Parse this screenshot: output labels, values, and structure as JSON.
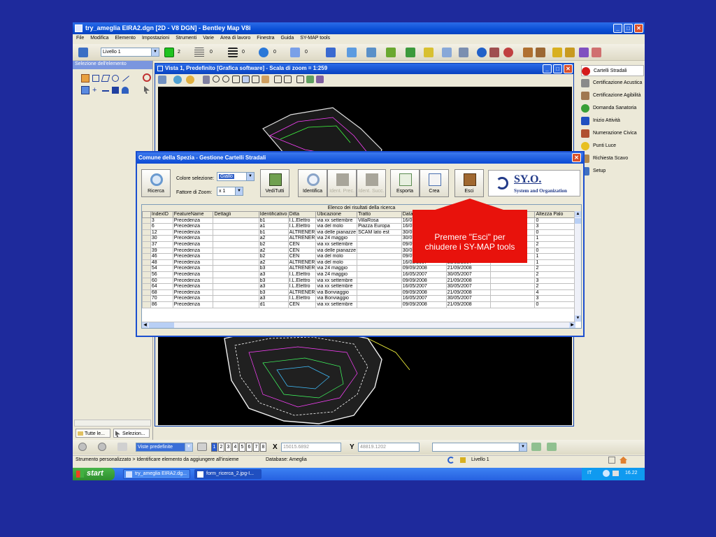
{
  "app": {
    "title": "try_ameglia EIRA2.dgn [2D - V8 DGN] - Bentley Map V8i",
    "menu": [
      "File",
      "Modifica",
      "Elemento",
      "Impostazioni",
      "Strumenti",
      "Varie",
      "Area di lavoro",
      "Finestra",
      "Guida",
      "SY-MAP tools"
    ],
    "level_combo": "Livello 1",
    "toolbar_values": [
      "2",
      "0",
      "0",
      "0",
      "0"
    ]
  },
  "left_panel": {
    "title": "Selezione dell'elemento",
    "tabs": [
      "Tutte le...",
      "Selezion..."
    ]
  },
  "right_panel": {
    "items": [
      "Cartelli Stradali",
      "Certificazione Acustica",
      "Certificazione Agibilità",
      "Domanda Sanatoria",
      "Inizio Attività",
      "Numerazione Civica",
      "Punti Luce",
      "Richiesta Scavo",
      "Setup"
    ],
    "colors": [
      "#d41a1a",
      "#8a8a8a",
      "#a07850",
      "#38a038",
      "#2050c0",
      "#b05030",
      "#e8c020",
      "#b08850",
      "#4070c0"
    ]
  },
  "view": {
    "title": "Vista 1, Predefinito [Grafica software] - Scala di zoom = 1:259"
  },
  "dialog": {
    "title": "Comune della Spezia - Gestione Cartelli Stradali",
    "color_label": "Colore selezione:",
    "color_value": "Giallo",
    "zoom_label": "Fattore di Zoom:",
    "zoom_value": "x 1",
    "buttons": {
      "ricerca": "Ricerca",
      "veditutti": "VediTutti",
      "identifica": "Identifica",
      "prec": "Ident. Prec.",
      "succ": "Ident. Succ.",
      "esporta": "Esporta",
      "crea": "Crea",
      "esci": "Esci"
    },
    "logo_main": "SY.O.",
    "logo_sub": "System and Organization",
    "grid_caption": "Elenco dei risultati della ricerca",
    "columns": [
      "IndexID",
      "FeatureName",
      "Dettagli",
      "Identificativo",
      "Ditta",
      "Ubicazione",
      "Tratto",
      "Data Installazione",
      "Entrata",
      "Interventi",
      "Altezza Palo"
    ],
    "rows": [
      [
        "3",
        "Precedenza",
        "",
        "b1",
        "I.L.Elettro",
        "via xx settembre",
        "VillaRosa",
        "16/05/2007",
        "30/05/2",
        "",
        "0"
      ],
      [
        "6",
        "Precedenza",
        "",
        "a1",
        "I.L.Elettro",
        "via del molo",
        "Piazza Europa",
        "16/05/200",
        "",
        "",
        "3"
      ],
      [
        "12",
        "Precedenza",
        "",
        "b1",
        "ALTRENER",
        "via delle pianazze",
        "SCAM lato est",
        "30/05/200",
        "",
        "",
        "0"
      ],
      [
        "30",
        "Precedenza",
        "",
        "a2",
        "ALTRENER",
        "via 24 maggio",
        "",
        "30/05/200",
        "",
        "",
        "1"
      ],
      [
        "37",
        "Precedenza",
        "",
        "b2",
        "CEN",
        "via xx settembre",
        "",
        "09/09/200",
        "",
        "",
        "2"
      ],
      [
        "39",
        "Precedenza",
        "",
        "a2",
        "CEN",
        "via delle pianazze",
        "",
        "30/05/200",
        "",
        "",
        "0"
      ],
      [
        "46",
        "Precedenza",
        "",
        "b2",
        "CEN",
        "via del molo",
        "",
        "09/09/200",
        "",
        "",
        "1"
      ],
      [
        "48",
        "Precedenza",
        "",
        "a2",
        "ALTRENER",
        "via del molo",
        "",
        "16/05/2007",
        "30/05/2007",
        "",
        "1"
      ],
      [
        "54",
        "Precedenza",
        "",
        "b3",
        "ALTRENER",
        "via 24 maggio",
        "",
        "09/09/2008",
        "21/09/2008",
        "",
        "2"
      ],
      [
        "56",
        "Precedenza",
        "",
        "a3",
        "I.L.Elettro",
        "via 24 maggio",
        "",
        "16/05/2007",
        "30/05/2007",
        "",
        "2"
      ],
      [
        "60",
        "Precedenza",
        "",
        "b3",
        "I.L.Elettro",
        "via xx settembre",
        "",
        "09/09/2008",
        "21/09/2008",
        "",
        "3"
      ],
      [
        "64",
        "Precedenza",
        "",
        "a3",
        "I.L.Elettro",
        "via xx settembre",
        "",
        "16/05/2007",
        "30/05/2007",
        "",
        "2"
      ],
      [
        "68",
        "Precedenza",
        "",
        "b3",
        "ALTRENER",
        "via Bonviaggio",
        "",
        "09/09/2008",
        "21/09/2008",
        "",
        "4"
      ],
      [
        "70",
        "Precedenza",
        "",
        "a3",
        "I.L.Elettro",
        "via Bonviaggio",
        "",
        "16/05/2007",
        "30/05/2007",
        "",
        "3"
      ],
      [
        "86",
        "Precedenza",
        "",
        "d1",
        "CEN",
        "via xx settembre",
        "",
        "09/09/2008",
        "21/09/2008",
        "",
        "0"
      ]
    ]
  },
  "callout": {
    "line1": "Premere \"Esci\" per",
    "line2": "chiudere i SY-MAP tools",
    "color": "#e8120c"
  },
  "nav": {
    "views_combo": "Viste predefinite",
    "view_numbers": [
      "1",
      "2",
      "3",
      "4",
      "5",
      "6",
      "7",
      "8"
    ],
    "x_label": "X",
    "x_value": "15015.6892",
    "y_label": "Y",
    "y_value": "48819.1202"
  },
  "status": {
    "message": "Strumento personalizzato > Identificare elemento da aggiungere all'insieme",
    "database": "Database: Ameglia",
    "level": "Livello 1"
  },
  "taskbar": {
    "start": "start",
    "tasks": [
      "try_ameglia EIRA2.dg...",
      "form_ricerca_2.jpg-I..."
    ],
    "lang": "IT",
    "clock": "16.22"
  }
}
